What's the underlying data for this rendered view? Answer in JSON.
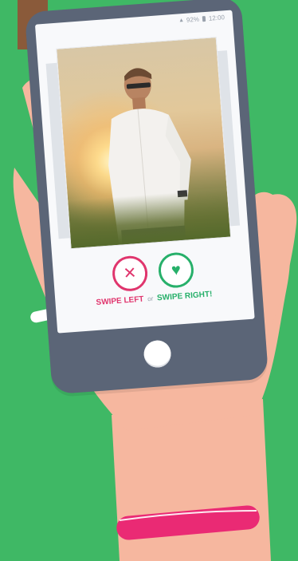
{
  "status": {
    "signal": "▲",
    "battery": "92%",
    "time": "12:00"
  },
  "actions": {
    "dislike_icon": "✕",
    "like_icon": "♥",
    "swipe_left_label": "SWIPE LEFT",
    "or_label": "or",
    "swipe_right_label": "SWIPE RIGHT!"
  },
  "colors": {
    "background": "#3fb865",
    "dislike": "#e0356d",
    "like": "#27b06a",
    "phone": "#5b6577",
    "skin": "#f6b79f"
  }
}
